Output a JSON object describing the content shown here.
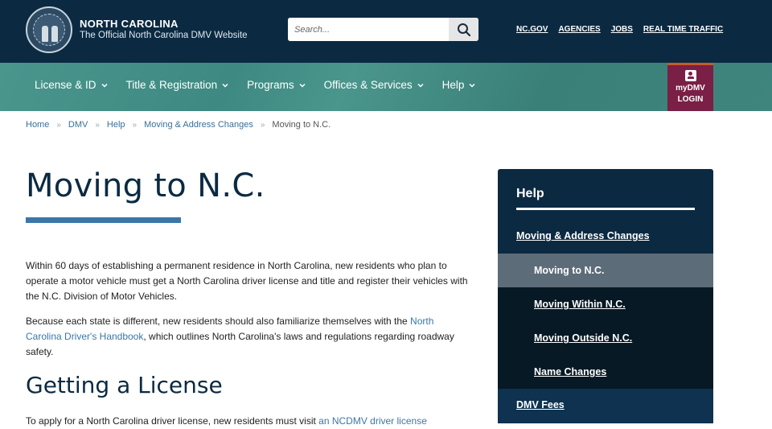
{
  "header": {
    "brand_title": "NORTH CAROLINA",
    "brand_subtitle": "The Official North Carolina DMV Website",
    "search_placeholder": "Search...",
    "search_icon": "magnifier-icon",
    "top_links": [
      "NC.GOV",
      "AGENCIES",
      "JOBS",
      "REAL TIME TRAFFIC"
    ]
  },
  "nav": {
    "items": [
      {
        "label": "License & ID"
      },
      {
        "label": "Title & Registration"
      },
      {
        "label": "Programs"
      },
      {
        "label": "Offices & Services"
      },
      {
        "label": "Help"
      }
    ],
    "mydmv": {
      "line1": "myDMV",
      "line2": "LOGIN",
      "icon": "user-badge-icon"
    }
  },
  "breadcrumb": {
    "items": [
      "Home",
      "DMV",
      "Help",
      "Moving & Address Changes"
    ],
    "current": "Moving to N.C.",
    "separator": "»"
  },
  "main": {
    "title": "Moving to N.C.",
    "para1": "Within 60 days of establishing a permanent residence in North Carolina, new residents who plan to operate a motor vehicle must get a North Carolina driver license and title and register their vehicles with the N.C. Division of Motor Vehicles.",
    "para2_before": "Because each state is different, new residents should also familiarize themselves with the ",
    "para2_link": "North Carolina Driver's Handbook",
    "para2_after": ", which outlines North Carolina's laws and regulations regarding roadway safety.",
    "h2": "Getting a License",
    "para3_before": "To apply for a North Carolina driver license, new residents must visit ",
    "para3_link": "an NCDMV driver license"
  },
  "sidebar": {
    "title": "Help",
    "items": [
      {
        "label": "Moving & Address Changes",
        "level": 1
      },
      {
        "label": "Moving to N.C.",
        "level": 2,
        "active": true
      },
      {
        "label": "Moving Within N.C.",
        "level": 2
      },
      {
        "label": "Moving Outside N.C.",
        "level": 2
      },
      {
        "label": "Name Changes",
        "level": 2
      },
      {
        "label": "DMV Fees",
        "level": 1
      }
    ]
  }
}
